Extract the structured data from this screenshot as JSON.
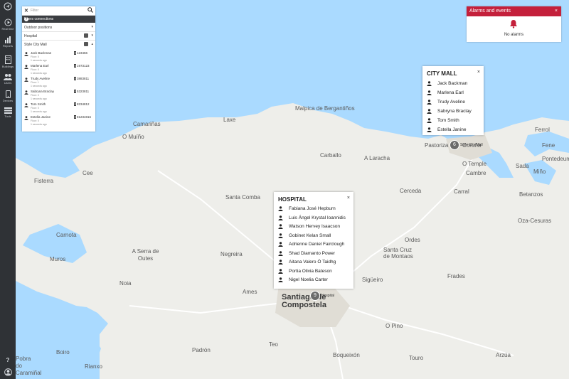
{
  "rail": {
    "items": [
      {
        "label": "",
        "icon": "navigation-icon"
      },
      {
        "label": "Real time",
        "icon": "play-icon"
      },
      {
        "label": "Reports",
        "icon": "bar-chart-icon"
      },
      {
        "label": "Buildings",
        "icon": "building-icon"
      },
      {
        "label": "Users",
        "icon": "users-icon"
      },
      {
        "label": "Devices",
        "icon": "phone-icon"
      },
      {
        "label": "Tools",
        "icon": "tools-icon"
      }
    ],
    "bottom": [
      {
        "label": "?",
        "icon": "help-icon"
      },
      {
        "label": "",
        "icon": "account-icon"
      }
    ]
  },
  "panel": {
    "filter_placeholder": "Filter",
    "user_connections": "Users connections",
    "help": "?",
    "outdoor": "Outdoor positions",
    "hospital": "Hospital",
    "mall": "Style City Mall",
    "users": [
      {
        "name": "Jack Backman",
        "floor": "Floor: 0",
        "ago": "1 seconds ago",
        "phone": "123456"
      },
      {
        "name": "Marlena Earl",
        "floor": "Floor: 0",
        "ago": "1 seconds ago",
        "phone": "1973123"
      },
      {
        "name": "Trudy Aveline",
        "floor": "Floor: 1",
        "ago": "1 seconds ago",
        "phone": "3883811"
      },
      {
        "name": "Sabryna Braclay",
        "floor": "Floor: 0",
        "ago": "1 seconds ago",
        "phone": "5323811"
      },
      {
        "name": "Tom Smith",
        "floor": "Floor: 0",
        "ago": "1 seconds ago",
        "phone": "8234812"
      },
      {
        "name": "Estella Janine",
        "floor": "Floor: 0",
        "ago": "1 seconds ago",
        "phone": "81234816"
      }
    ]
  },
  "alarms": {
    "title": "Alarms and events",
    "close": "×",
    "empty": "No alarms",
    "color": "#c4203b"
  },
  "city_mall_popup": {
    "title": "CITY MALL",
    "close": "×",
    "people": [
      "Jack Backman",
      "Marlena Earl",
      "Trudy Aveline",
      "Sabryna Braclay",
      "Tom Smith",
      "Estella Janine"
    ]
  },
  "hospital_popup": {
    "title": "HOSPITAL",
    "close": "×",
    "people": [
      "Fabiana José Hepburn",
      "Luis Ángel Krystal Ioannidis",
      "Watson Hervey Isaacson",
      "Gobinet Kelan Small",
      "Adrienne Daniel Fairclough",
      "Shad Diamanto Power",
      "Aitana Valero Ó Taidhg",
      "Portia Olivia Bateson",
      "Nigel Noelia Carter"
    ]
  },
  "markers": {
    "mall_count": "6",
    "mall_label": "Style City Mall",
    "hospital_count": "9",
    "hospital_label": "Hospital"
  },
  "places": {
    "malpica": "Malpica de Bergantiños",
    "camarinas": "Camariñas",
    "laxe": "Laxe",
    "omuino": "O Muíño",
    "carballo": "Carballo",
    "alaracha": "A Laracha",
    "pastoriza": "Pastoriza",
    "coruna": "Coruña",
    "otemple": "O Temple",
    "cambre": "Cambre",
    "ferrol": "Ferrol",
    "fene": "Fene",
    "pontedeume": "Pontedeume",
    "sada": "Sada",
    "mino": "Miño",
    "betanzos": "Betanzos",
    "cee": "Cee",
    "fisterra": "Fisterra",
    "santacomba": "Santa Comba",
    "cerceda": "Cerceda",
    "carral": "Carral",
    "oza": "Oza-Cesuras",
    "carnota": "Carnota",
    "ordes": "Ordes",
    "muros": "Muros",
    "aserra": "A Serra de Outes",
    "negreira": "Negreira",
    "santacruz": "Santa Cruz de Montaos",
    "frades": "Frades",
    "noia": "Noia",
    "ames": "Ames",
    "sigueiro": "Sigüeiro",
    "santiago": "Santiago de Compostela",
    "opino": "O Pino",
    "boiro": "Boiro",
    "padron": "Padrón",
    "teo": "Teo",
    "boqueixon": "Boqueixón",
    "touro": "Touro",
    "arzua": "Arzúa",
    "riaxo": "Rianxo",
    "pobra": "Pobra do Caramiñal"
  },
  "colors": {
    "sea": "#aadaff",
    "land": "#eeeeea",
    "rail": "#2f3236"
  }
}
